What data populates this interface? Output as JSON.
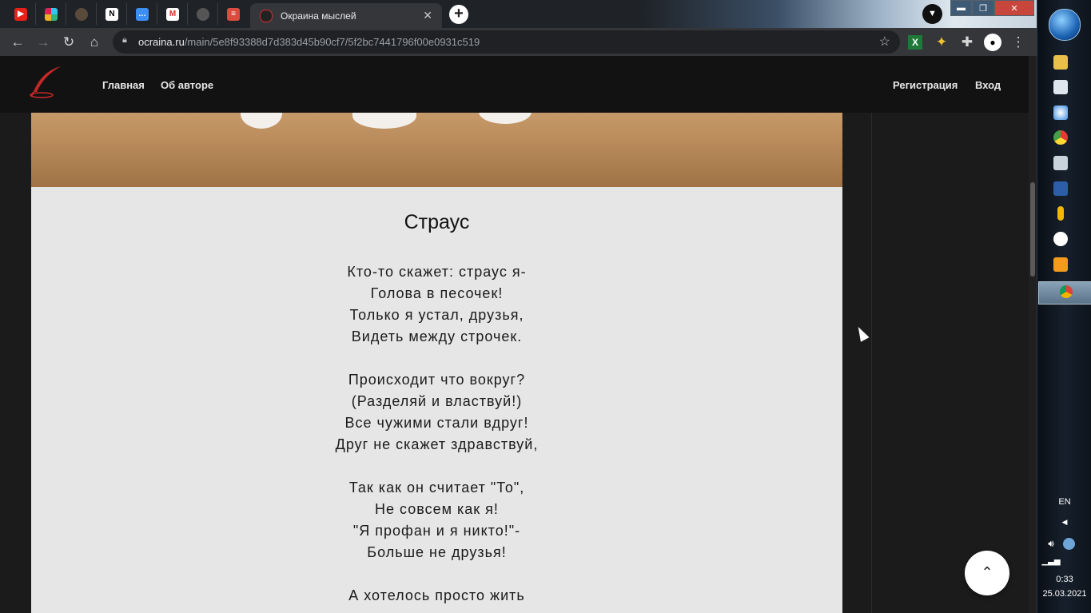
{
  "browser": {
    "tab_favicons": [
      "youtube",
      "slack",
      "owl",
      "notion",
      "messages",
      "gmail",
      "github",
      "todoist"
    ],
    "active_tab_title": "Окраина мыслей",
    "url_domain": "ocraina.ru",
    "url_path": "/main/5e8f93388d7d383d45b90cf7/5f2bc7441796f00e0931c519"
  },
  "site": {
    "nav_home": "Главная",
    "nav_about": "Об авторе",
    "nav_register": "Регистрация",
    "nav_login": "Вход"
  },
  "poem": {
    "title": "Страус",
    "lines": [
      "Кто-то скажет: страус я-",
      "Голова в песочек!",
      "Только я устал, друзья,",
      "Видеть между строчек.",
      "",
      "Происходит что вокруг?",
      "(Разделяй и властвуй!)",
      "Все чужими стали вдруг!",
      "Друг не скажет здравствуй,",
      "",
      "Так как он считает \"То\",",
      "Не совсем как я!",
      "\"Я профан и я никто!\"-",
      "Больше не друзья!",
      "",
      "А хотелось просто жить"
    ]
  },
  "taskbar": {
    "language": "EN",
    "time": "0:33",
    "date": "25.03.2021"
  },
  "colors": {
    "accent_red": "#d32f2f",
    "card_bg": "#e6e6e6",
    "header_bg": "#121212"
  }
}
